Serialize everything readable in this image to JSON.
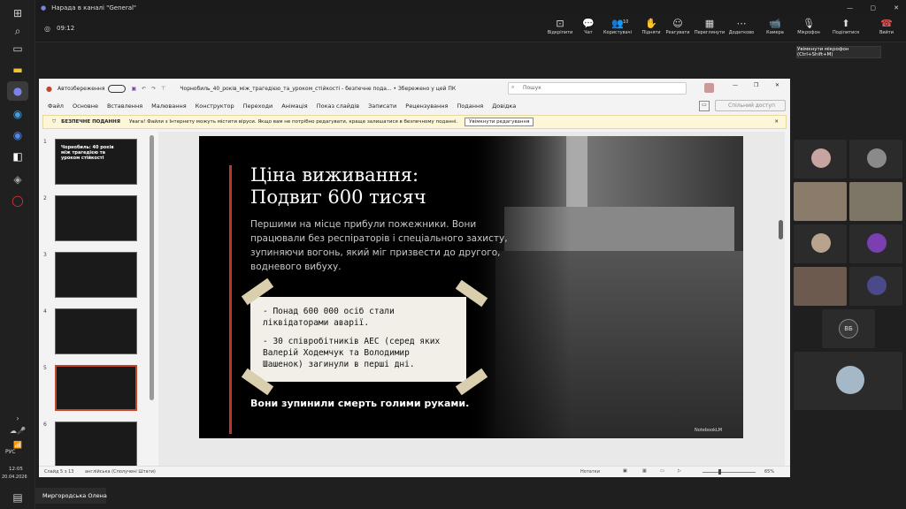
{
  "titlebar": {
    "title": "Нарада в каналі \"General\""
  },
  "meeting": {
    "time": "09:12",
    "controls": [
      {
        "label": "Відкріпити",
        "icon": "unpin-icon",
        "glyph": "⊡"
      },
      {
        "label": "Чат",
        "icon": "chat-icon",
        "glyph": "💬"
      },
      {
        "label": "Користувачі",
        "icon": "people-icon",
        "glyph": "👥",
        "count": "10"
      },
      {
        "label": "Підняти",
        "icon": "raise-hand-icon",
        "glyph": "✋"
      },
      {
        "label": "Реагувати",
        "icon": "react-icon",
        "glyph": "☺"
      },
      {
        "label": "Переглянути",
        "icon": "view-icon",
        "glyph": "▦"
      },
      {
        "label": "Додатково",
        "icon": "more-icon",
        "glyph": "⋯"
      },
      {
        "label": "Камера",
        "icon": "camera-icon",
        "glyph": "📹"
      },
      {
        "label": "Мікрофон",
        "icon": "mic-icon",
        "glyph": "🎙"
      },
      {
        "label": "Поділитися",
        "icon": "share-icon",
        "glyph": "⬆"
      },
      {
        "label": "Вийти",
        "icon": "leave-icon",
        "glyph": "☎"
      }
    ],
    "tooltip": "Увімкнути мікрофон (Ctrl+Shift+M)"
  },
  "ppt": {
    "autosave": "Автозбереження",
    "doc_title": "Чорнобиль_40_років_між_трагедією_та_уроком_стійкості  -  безпечне пода...  •  Збережено у цей ПК",
    "search_placeholder": "Пошук",
    "menu": [
      "Файл",
      "Основне",
      "Вставлення",
      "Малювання",
      "Конструктор",
      "Переходи",
      "Анімація",
      "Показ слайдів",
      "Записати",
      "Рецензування",
      "Подання",
      "Довідка"
    ],
    "share": "Спільний доступ",
    "warning": {
      "title": "БЕЗПЕЧНЕ ПОДАННЯ",
      "text": "Увага! Файли з Інтернету можуть містити віруси. Якщо вам не потрібно редагувати, краще залишатися в безпечному поданні.",
      "button": "Увімкнути редагування"
    },
    "thumbs": [
      {
        "n": "1",
        "caption": "Чорнобиль: 40 років між трагедією та уроком стійкості"
      },
      {
        "n": "2",
        "caption": ""
      },
      {
        "n": "3",
        "caption": ""
      },
      {
        "n": "4",
        "caption": ""
      },
      {
        "n": "5",
        "caption": ""
      },
      {
        "n": "6",
        "caption": ""
      }
    ],
    "slide": {
      "title1": "Ціна виживання:",
      "title2": "Подвиг 600 тисяч",
      "body": "Першими на місце прибули пожежники. Вони працювали без респіраторів і спеціального захисту, зупиняючи вогонь, який міг призвести до другого, водневого вибуху.",
      "note1": "- Понад 600 000 осіб стали ліквідаторами аварії.",
      "note2": "- 30 співробітників АЕС (серед яких Валерій Ходемчук та Володимир Шашенок) загинули в перші дні.",
      "footer": "Вони зупинили смерть голими руками.",
      "watermark": "NotebookLM"
    },
    "status": {
      "slide": "Слайд 5 з 13",
      "lang": "англійська (Сполучені Штати)",
      "notes": "Нотатки",
      "zoom": "65%"
    }
  },
  "taskbar": {
    "lang": "РУС",
    "time": "12:05",
    "date": "20.04.2026"
  },
  "participant": {
    "name": "Миргородська Олена"
  },
  "people": {
    "initials": "ВБ"
  }
}
